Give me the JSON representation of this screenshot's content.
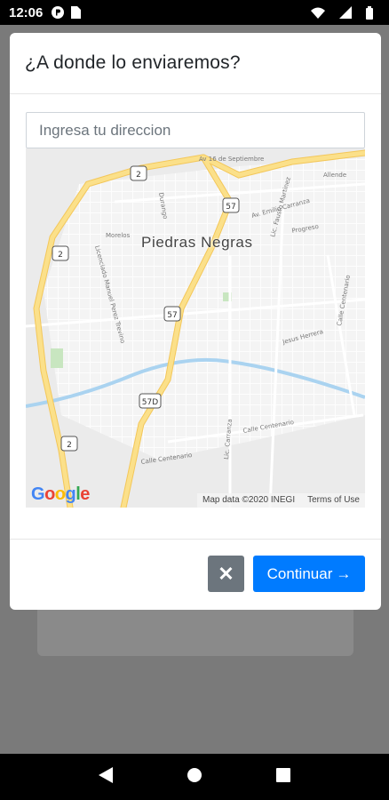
{
  "status_bar": {
    "time": "12:06",
    "icons": [
      "app-notification-icon",
      "sim-card-icon",
      "wifi-icon",
      "signal-icon",
      "battery-icon"
    ]
  },
  "modal": {
    "title": "¿A donde lo enviaremos?",
    "address_input": {
      "placeholder": "Ingresa tu direccion",
      "value": ""
    },
    "map": {
      "city_label": "Piedras Negras",
      "attribution": "Map data ©2020 INEGI",
      "terms": "Terms of Use",
      "logo_letters": [
        "G",
        "o",
        "o",
        "g",
        "l",
        "e"
      ],
      "route_shields": [
        "2",
        "57",
        "2",
        "57",
        "57D",
        "2"
      ],
      "street_labels": [
        "Av 16 de Septiembre",
        "Av. Emilio Carranza",
        "Allende",
        "Progreso",
        "Calle Centenario",
        "Calle Centenario",
        "Lic. Fausto Martinez",
        "Jesus Herrera",
        "Calle Centenario",
        "Lic. Carranza",
        "Durango",
        "Morelos",
        "Licenciado Manuel Perez Trevino"
      ],
      "colors": {
        "background": "#ebebeb",
        "highway": "#fbe08a",
        "highway_stroke": "#f3c75a",
        "street": "#ffffff",
        "water": "#aad3f0",
        "park": "#c8e6c0"
      }
    },
    "footer": {
      "close_label": "✕",
      "continue_label": "Continuar",
      "continue_icon": "→"
    }
  },
  "colors": {
    "primary": "#007bff",
    "secondary": "#6c757d",
    "backdrop": "#7a7a7a"
  }
}
